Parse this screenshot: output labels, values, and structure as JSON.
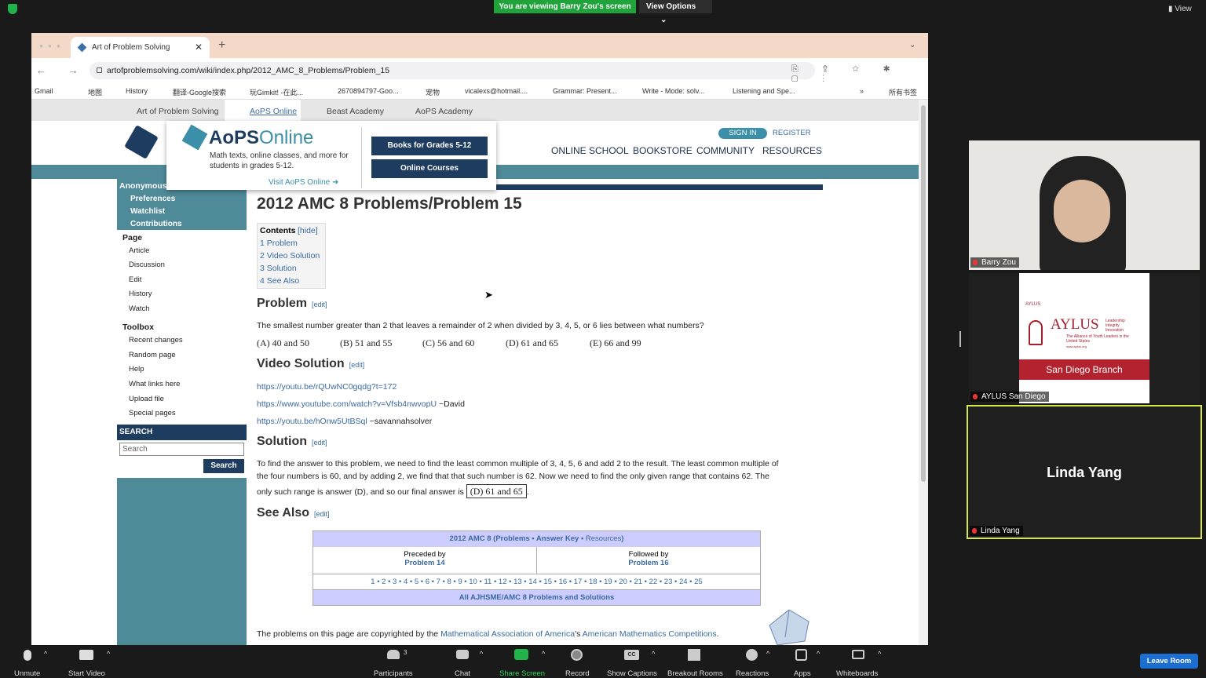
{
  "zoom": {
    "banner": "You are viewing Barry Zou's screen",
    "view_options": "View Options",
    "view": "View",
    "chevron": "⌄"
  },
  "browser": {
    "tab_title": "Art of Problem Solving",
    "tab_close": "✕",
    "new_tab": "+",
    "tab_menu": "⌄",
    "url": "artofproblemsolving.com/wiki/index.php/2012_AMC_8_Problems/Problem_15",
    "bookmarks": [
      "Gmail",
      "地图",
      "History",
      "翻译-Google搜索",
      "玩Gimkit! -在此...",
      "2670894797-Goo...",
      "宠物",
      "vicalexs@hotmail....",
      "Grammar: Present...",
      "Write - Mode: solv...",
      "Listening and Spe...",
      "»",
      "所有书签"
    ],
    "nav_icons": "← → ↻",
    "addr_icons": "⎘ ⇪ ☆ ✱ ▢ ⋮"
  },
  "site": {
    "tabs": [
      "Art of Problem Solving",
      "AoPS Online",
      "Beast Academy",
      "AoPS Academy"
    ],
    "sign_in": "SIGN IN",
    "register": "REGISTER",
    "nav": [
      "ONLINE SCHOOL",
      "BOOKSTORE",
      "COMMUNITY",
      "RESOURCES"
    ],
    "popup": {
      "title_a": "AoPS",
      "title_b": "Online",
      "desc": "Math texts, online classes, and more for students in grades 5-12.",
      "visit": "Visit AoPS Online ➜",
      "btn1": "Books for Grades 5-12",
      "btn2": "Online Courses"
    }
  },
  "sidebar": {
    "user": "Anonymous",
    "user_links": [
      "Preferences",
      "Watchlist",
      "Contributions"
    ],
    "page_h": "Page",
    "page_links": [
      "Article",
      "Discussion",
      "Edit",
      "History",
      "Watch"
    ],
    "toolbox_h": "Toolbox",
    "toolbox_links": [
      "Recent changes",
      "Random page",
      "Help",
      "What links here",
      "Upload file",
      "Special pages"
    ],
    "search_h": "SEARCH",
    "search_placeholder": "Search",
    "search_btn": "Search"
  },
  "article": {
    "title": "2012 AMC 8 Problems/Problem 15",
    "contents": "Contents",
    "hide": "[hide]",
    "toc": [
      "1 Problem",
      "2 Video Solution",
      "3 Solution",
      "4 See Also"
    ],
    "edit": "[edit]",
    "h_problem": "Problem",
    "problem": "The smallest number greater than 2 that leaves a remainder of 2 when divided by 3, 4, 5, or 6 lies between what numbers?",
    "choices": [
      "(A) 40 and 50",
      "(B) 51 and 55",
      "(C) 56 and 60",
      "(D) 61 and 65",
      "(E) 66 and 99"
    ],
    "h_video": "Video Solution",
    "videos": [
      {
        "url": "https://youtu.be/rQUwNC0gqdg?t=172",
        "by": ""
      },
      {
        "url": "https://www.youtube.com/watch?v=Vfsb4nwvopU",
        "by": " ~David"
      },
      {
        "url": "https://youtu.be/hOnw5UtBSql",
        "by": " ~savannahsolver"
      }
    ],
    "h_solution": "Solution",
    "sol1": "To find the answer to this problem, we need to find the least common multiple of 3, 4, 5, 6 and add 2 to the result. The least common multiple of",
    "sol2": "the four numbers is 60, and by adding 2, we find that that such number is 62. Now we need to find the only given range that contains 62. The",
    "sol3": "only such range is answer (D), and so our final answer is",
    "boxed": "(D) 61 and 65",
    "period": ".",
    "h_see": "See Also",
    "see": {
      "head_a": "2012 AMC 8 (",
      "head_p": "Problems",
      "head_dot": " • ",
      "head_ak": "Answer Key",
      "head_r": "Resources",
      "head_close": ")",
      "prev_l": "Preceded by",
      "prev": "Problem 14",
      "next_l": "Followed by",
      "next": "Problem 16",
      "nums": "1 • 2 • 3 • 4 • 5 • 6 • 7 • 8 • 9 • 10 • 11 • 12 • 13 • 14 • 15 • 16 • 17 • 18 • 19 • 20 • 21 • 22 • 23 • 24 • 25",
      "all": "All AJHSME/AMC 8 Problems and Solutions"
    },
    "copy_a": "The problems on this page are copyrighted by the ",
    "copy_maa": "Mathematical Association of America",
    "copy_b": "'s ",
    "copy_amc": "American Mathematics Competitions",
    "copy_c": "."
  },
  "participants": {
    "p1": "Barry Zou",
    "p2": "AYLUS San Diego",
    "p3": "Linda Yang",
    "aylus_small": "AYLUS",
    "aylus_big": "AYLUS",
    "aylus_tag": "Leadership\nIntegrity\nInnovation",
    "aylus_sub": "The Alliance of Youth Leaders in the United States",
    "aylus_url": "www.aylus.org",
    "aylus_branch": "San Diego Branch"
  },
  "bottom": {
    "unmute": "Unmute",
    "start_video": "Start Video",
    "participants": "Participants",
    "participants_count": "3",
    "chat": "Chat",
    "share": "Share Screen",
    "record": "Record",
    "captions": "Show Captions",
    "breakout": "Breakout Rooms",
    "reactions": "Reactions",
    "apps": "Apps",
    "whiteboards": "Whiteboards",
    "leave": "Leave Room",
    "cc": "CC",
    "caret": "^"
  }
}
